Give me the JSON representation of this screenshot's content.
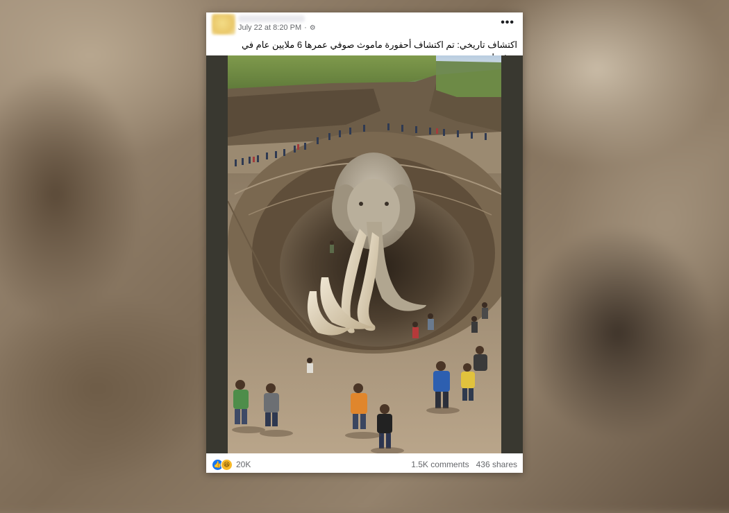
{
  "post": {
    "date": "July 22 at 8:20 PM",
    "separator": "·",
    "privacy_icon": "gear-icon",
    "more_icon": "more-horizontal-icon",
    "caption": "اكتشاف تاريخي: تم اكتشاف أحفورة ماموث صوفي عمرها 6 ملايين عام في ميشيغان."
  },
  "footer": {
    "reaction_icons": [
      "like-icon",
      "haha-icon"
    ],
    "reaction_count": "20K",
    "comments": "1.5K comments",
    "shares": "436 shares"
  },
  "colors": {
    "like_blue": "#1877f2",
    "haha_yellow": "#f7b928",
    "meta_gray": "#65676b"
  }
}
